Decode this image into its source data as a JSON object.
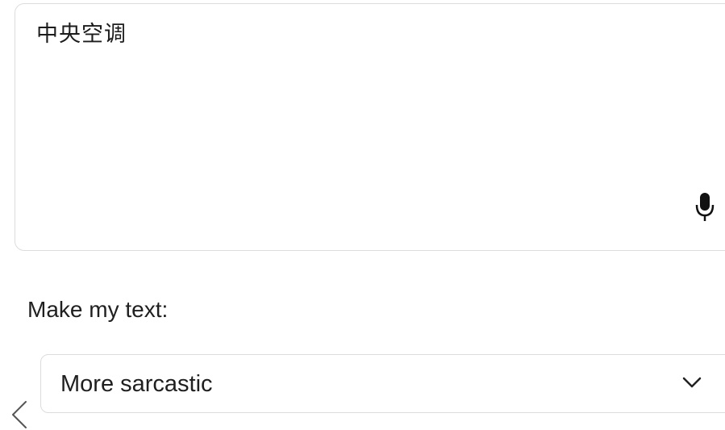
{
  "input": {
    "value": "中央空调",
    "mic_icon": "microphone-icon"
  },
  "tone": {
    "label": "Make my text:",
    "selected": "More sarcastic",
    "dropdown_icon": "chevron-down-icon"
  },
  "navigation": {
    "back_icon": "chevron-left-icon"
  }
}
